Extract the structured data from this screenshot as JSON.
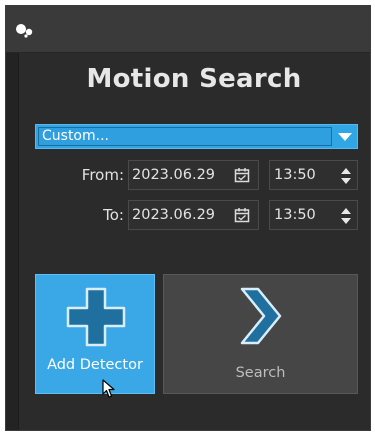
{
  "panel": {
    "heading": "Motion Search"
  },
  "preset": {
    "selected": "Custom...",
    "accent": "#31a6e4"
  },
  "range": {
    "from": {
      "label": "From:",
      "date": "2023.06.29",
      "time": "13:50"
    },
    "to": {
      "label": "To:",
      "date": "2023.06.29",
      "time": "13:50"
    }
  },
  "actions": {
    "add_detector_label": "Add Detector",
    "search_label": "Search",
    "add_color": "#3aa8e6",
    "icon_color": "#1f6f9f"
  },
  "icons": {
    "app": "app-logo-icon",
    "calendar": "calendar-icon",
    "spin": "spin-updown-icon",
    "plus": "plus-icon",
    "chevron": "chevron-right-icon",
    "cursor": "mouse-pointer-icon"
  }
}
